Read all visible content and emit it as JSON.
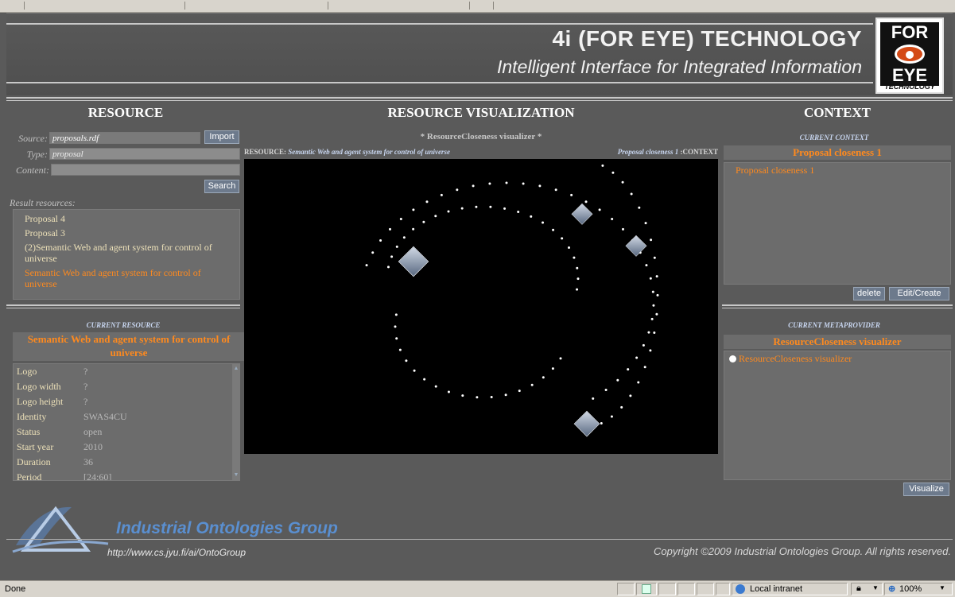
{
  "header": {
    "title": "4i (FOR EYE) TECHNOLOGY",
    "subtitle": "Intelligent Interface for Integrated Information",
    "logo_top": "FOR",
    "logo_bottom": "EYE",
    "logo_tech": "TECHNOLOGY"
  },
  "resource": {
    "title": "RESOURCE",
    "source_label": "Source:",
    "source_value": "proposals.rdf",
    "import_label": "Import",
    "type_label": "Type:",
    "type_value": "proposal",
    "content_label": "Content:",
    "content_value": "",
    "search_label": "Search",
    "results_label": "Result resources:",
    "results": [
      "Proposal 4",
      "Proposal 3",
      "(2)Semantic Web and agent system for control of universe",
      "Semantic Web and agent system for control of universe"
    ]
  },
  "current_resource": {
    "caption": "CURRENT RESOURCE",
    "name": "Semantic Web and agent system for control of universe",
    "properties": [
      {
        "key": "Logo",
        "value": "?"
      },
      {
        "key": "Logo width",
        "value": "?"
      },
      {
        "key": "Logo height",
        "value": "?"
      },
      {
        "key": "Identity",
        "value": "SWAS4CU"
      },
      {
        "key": "Status",
        "value": "open"
      },
      {
        "key": "Start year",
        "value": "2010"
      },
      {
        "key": "Duration",
        "value": "36"
      },
      {
        "key": "Period",
        "value": "[24;60]"
      }
    ]
  },
  "visualization": {
    "title": "RESOURCE VISUALIZATION",
    "subtitle": "* ResourceCloseness visualizer *",
    "resource_prefix": "RESOURCE:",
    "resource_name": "Semantic Web and agent system for control of universe",
    "context_name": "Proposal closeness 1",
    "context_suffix": ":CONTEXT"
  },
  "context": {
    "title": "CONTEXT",
    "caption": "CURRENT CONTEXT",
    "selected": "Proposal closeness 1",
    "items": [
      "Proposal closeness 1"
    ],
    "delete_label": "delete",
    "edit_label": "Edit/Create"
  },
  "metaprovider": {
    "caption": "CURRENT METAPROVIDER",
    "selected": "ResourceCloseness visualizer",
    "items": [
      "ResourceCloseness visualizer"
    ],
    "visualize_label": "Visualize"
  },
  "footer": {
    "group": "Industrial Ontologies Group",
    "url": "http://www.cs.jyu.fi/ai/OntoGroup",
    "copyright": "Copyright ©2009 Industrial Ontologies Group. All rights reserved."
  },
  "statusbar": {
    "status": "Done",
    "zone": "Local intranet",
    "zoom": "100%"
  },
  "colors": {
    "accent": "#ff8a1e",
    "caption_blue": "#c8d6f0",
    "background": "#5a5a5a"
  }
}
